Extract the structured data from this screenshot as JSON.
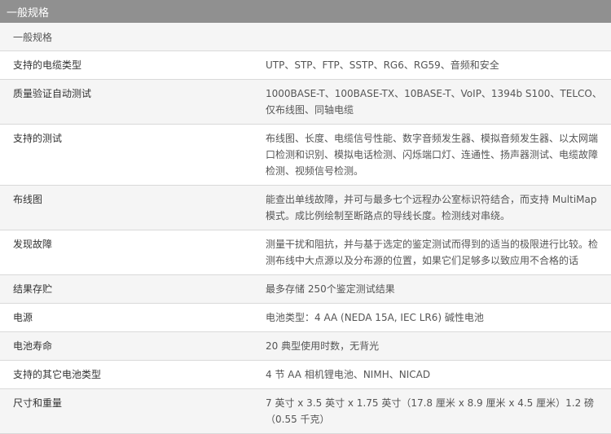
{
  "section": {
    "title": "一般规格",
    "subtitle": "一般规格"
  },
  "rows": [
    {
      "label": "支持的电缆类型",
      "value": "UTP、STP、FTP、SSTP、RG6、RG59、音频和安全"
    },
    {
      "label": "质量验证自动测试",
      "value": "1000BASE-T、100BASE-TX、10BASE-T、VoIP、1394b S100、TELCO、仅布线图、同轴电缆"
    },
    {
      "label": "支持的测试",
      "value": "布线图、长度、电缆信号性能、数字音频发生器、模拟音频发生器、以太网端口检测和识别、模拟电话检测、闪烁端口灯、连通性、扬声器测试、电缆故障检测、视频信号检测。"
    },
    {
      "label": "布线图",
      "value": "能查出单线故障，并可与最多七个远程办公室标识符结合，而支持 MultiMap 模式。成比例绘制至断路点的导线长度。检测线对串绕。"
    },
    {
      "label": "发现故障",
      "value": "测量干扰和阻抗，并与基于选定的鉴定测试而得到的适当的极限进行比较。检测布线中大点源以及分布源的位置，如果它们足够多以致应用不合格的话"
    },
    {
      "label": "结果存贮",
      "value": "最多存储 250个鉴定测试结果"
    },
    {
      "label": "电源",
      "value": "电池类型：4 AA (NEDA 15A, IEC LR6) 碱性电池"
    },
    {
      "label": "电池寿命",
      "value": "20 典型使用时数，无背光"
    },
    {
      "label": "支持的其它电池类型",
      "value": "4 节 AA 相机锂电池、NIMH、NICAD"
    },
    {
      "label": "尺寸和重量",
      "value": "7 英寸 x 3.5 英寸 x 1.75 英寸（17.8 厘米 x 8.9 厘米 x 4.5 厘米）1.2 磅 （0.55 千克）"
    }
  ]
}
